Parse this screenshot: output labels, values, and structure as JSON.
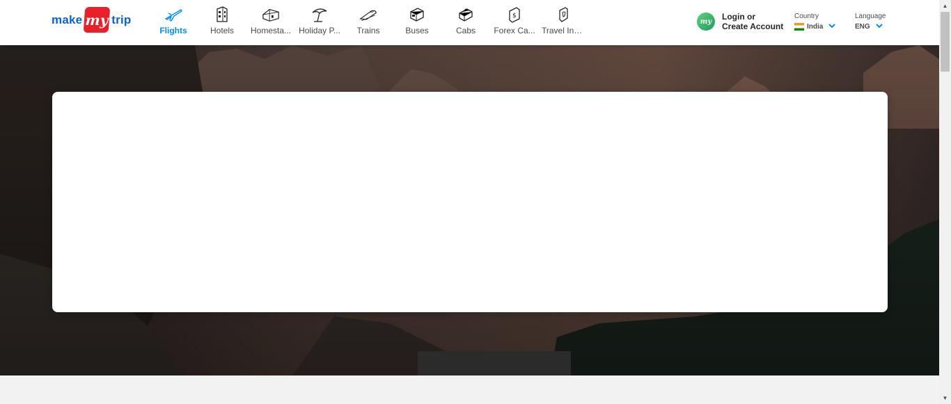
{
  "brand": {
    "word1": "make",
    "badge": "my",
    "word2": "trip"
  },
  "nav": [
    {
      "label": "Flights",
      "icon": "flight-icon",
      "active": true
    },
    {
      "label": "Hotels",
      "icon": "hotel-icon"
    },
    {
      "label": "Homestays & Villas",
      "display": "Homesta...",
      "icon": "homestay-icon"
    },
    {
      "label": "Holiday Packages",
      "display": "Holiday P...",
      "icon": "holiday-package-icon"
    },
    {
      "label": "Trains",
      "icon": "train-icon"
    },
    {
      "label": "Buses",
      "icon": "bus-icon"
    },
    {
      "label": "Cabs",
      "icon": "cab-icon"
    },
    {
      "label": "Forex Card & Currency",
      "display": "Forex Ca...",
      "icon": "forex-icon"
    },
    {
      "label": "Travel Insurance",
      "display": "Travel Ins...",
      "icon": "insurance-icon"
    }
  ],
  "login": {
    "line1": "Login or",
    "line2": "Create Account",
    "avatar": "my"
  },
  "country": {
    "caption": "Country",
    "value": "India"
  },
  "language": {
    "caption": "Language",
    "value": "ENG"
  },
  "colors": {
    "accent": "#008cff",
    "brand_blue": "#0a64c6",
    "brand_red": "#e8202a"
  }
}
